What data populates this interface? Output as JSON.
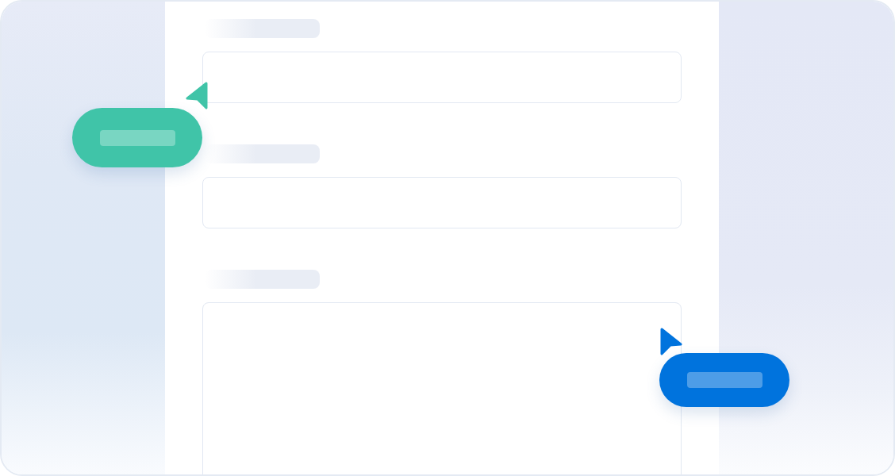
{
  "form": {
    "fields": [
      {
        "kind": "input",
        "cursor": {
          "kind": "left",
          "color": "#40c4a8"
        }
      },
      {
        "kind": "input"
      },
      {
        "kind": "textarea",
        "cursor": {
          "kind": "right",
          "color": "#0073dd"
        }
      }
    ]
  }
}
